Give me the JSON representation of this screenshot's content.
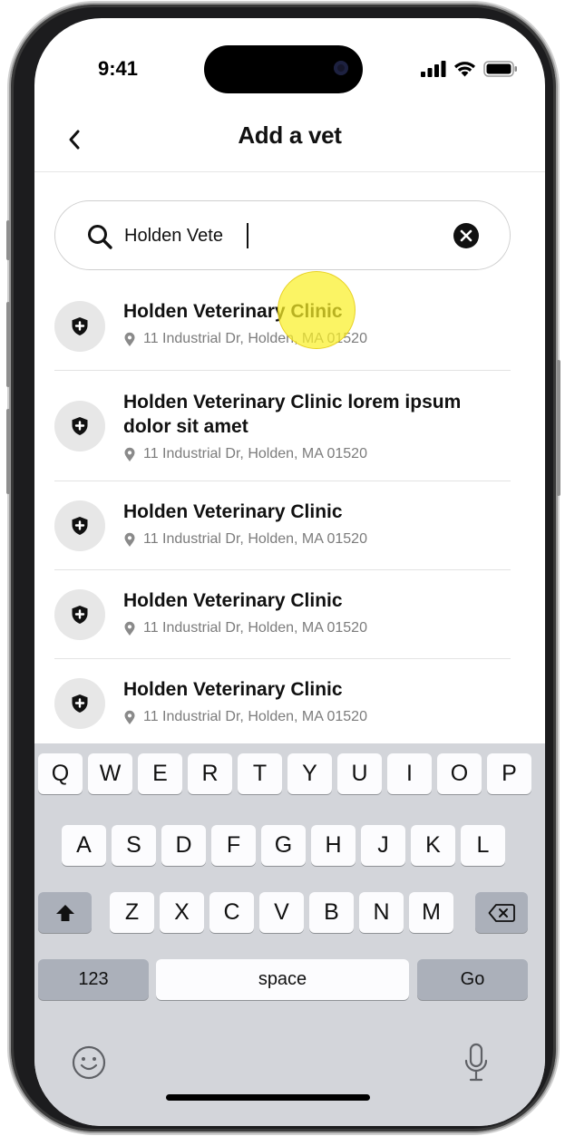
{
  "status_bar": {
    "time": "9:41",
    "icons": [
      "signal-icon",
      "wifi-icon",
      "battery-icon"
    ]
  },
  "nav": {
    "back_icon": "chevron-left-icon",
    "title": "Add a vet"
  },
  "search": {
    "value": "Holden Vete",
    "placeholder": "",
    "icon": "search-icon",
    "clear_icon": "clear-icon"
  },
  "results": [
    {
      "name": "Holden Veterinary Clinic",
      "address": "11 Industrial Dr, Holden, MA 01520"
    },
    {
      "name": "Holden Veterinary Clinic lorem ipsum dolor sit amet",
      "address": "11 Industrial Dr, Holden, MA 01520"
    },
    {
      "name": "Holden Veterinary Clinic",
      "address": "11 Industrial Dr, Holden, MA 01520"
    },
    {
      "name": "Holden Veterinary Clinic",
      "address": "11 Industrial Dr, Holden, MA 01520"
    },
    {
      "name": "Holden Veterinary Clinic",
      "address": "11 Industrial Dr, Holden, MA 01520"
    }
  ],
  "keyboard": {
    "row1": [
      "Q",
      "W",
      "E",
      "R",
      "T",
      "Y",
      "U",
      "I",
      "O",
      "P"
    ],
    "row2": [
      "A",
      "S",
      "D",
      "F",
      "G",
      "H",
      "J",
      "K",
      "L"
    ],
    "row3": [
      "Z",
      "X",
      "C",
      "V",
      "B",
      "N",
      "M"
    ],
    "numbers_label": "123",
    "space_label": "space",
    "go_label": "Go",
    "icons": [
      "shift-icon",
      "backspace-icon",
      "emoji-icon",
      "microphone-icon"
    ]
  },
  "colors": {
    "touch_indicator": "#F7EE2A",
    "badge_bg": "#E7E7E7",
    "keyboard_bg": "#D3D5DA"
  }
}
